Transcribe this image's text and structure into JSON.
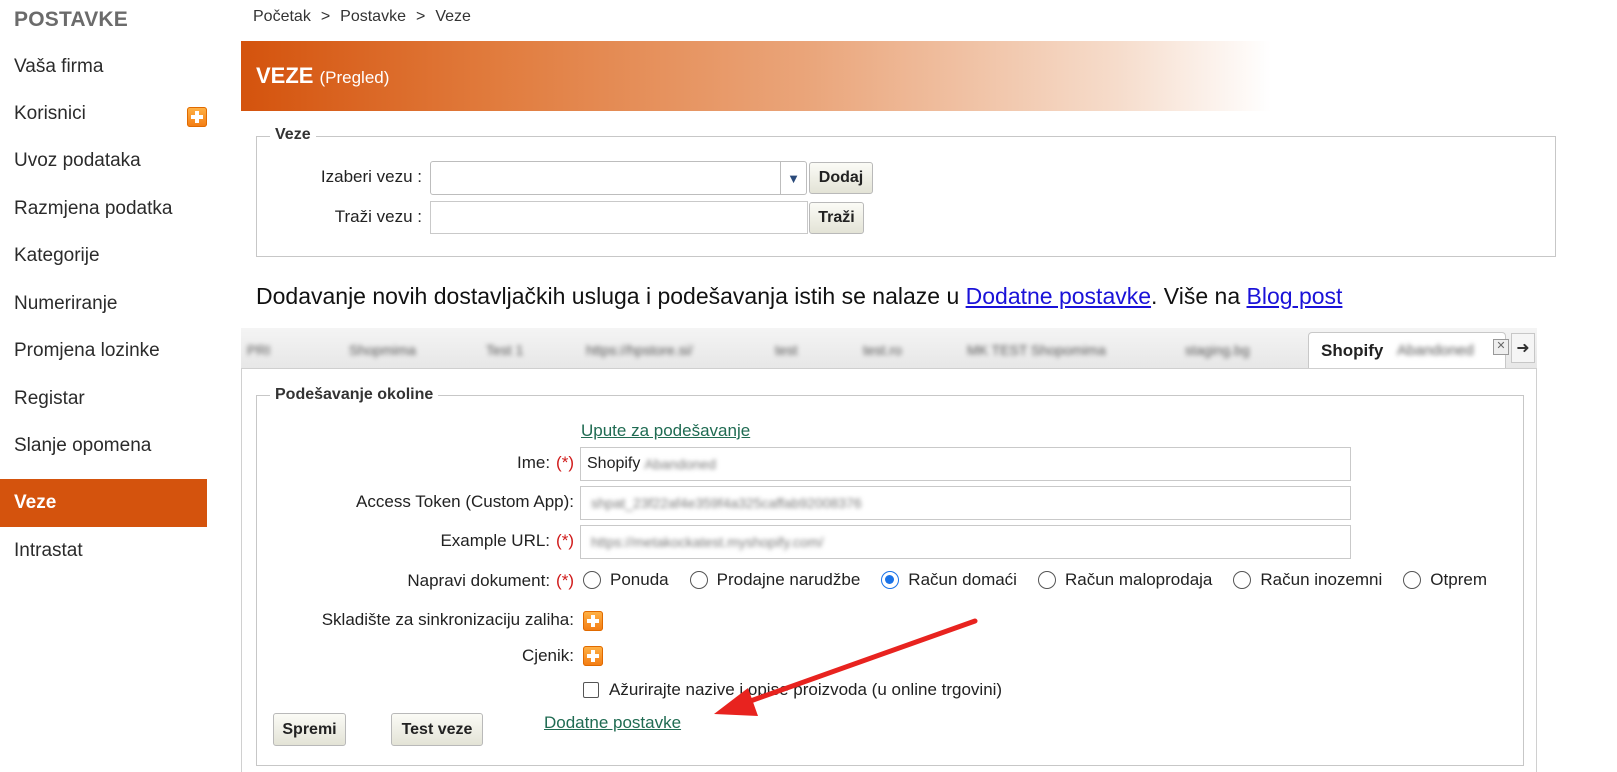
{
  "sidebar": {
    "title": "POSTAVKE",
    "items": [
      {
        "label": "Vaša firma"
      },
      {
        "label": "Korisnici"
      },
      {
        "label": "Uvoz podataka"
      },
      {
        "label": "Razmjena podatka"
      },
      {
        "label": "Kategorije"
      },
      {
        "label": "Numeriranje"
      },
      {
        "label": "Promjena lozinke"
      },
      {
        "label": "Registar"
      },
      {
        "label": "Slanje opomena"
      },
      {
        "label": "Veze"
      },
      {
        "label": "Intrastat"
      }
    ]
  },
  "breadcrumb": [
    "Početak",
    "Postavke",
    "Veze"
  ],
  "breadcrumb_sep": ">",
  "header": {
    "title": "VEZE",
    "subtitle": "(Pregled)",
    "accent": "#d4530d"
  },
  "veze_fieldset": {
    "legend": "Veze",
    "select_label": "Izaberi vezu :",
    "select_value": "",
    "add_button": "Dodaj",
    "search_label": "Traži vezu :",
    "search_value": "",
    "search_button": "Traži"
  },
  "info": {
    "text": "Dodavanje novih dostavljačkih usluga i podešavanja istih se nalaze u ",
    "link1": "Dodatne postavke",
    "middle": ". Više na ",
    "link2": "Blog post"
  },
  "tabs": {
    "items": [
      "PRI",
      "Shopmima",
      "Test 1",
      "https://hpstore.si/",
      "test",
      "test.ro",
      "MK TEST Shopomima",
      "staging.bg"
    ],
    "active": {
      "name": "Shopify",
      "suffix": "Abandoned"
    }
  },
  "env_fieldset": {
    "legend": "Podešavanje okoline",
    "guide_link": "Upute za podešavanje",
    "required_mark": "(*)",
    "name_label": "Ime:",
    "name_value": "Shopify",
    "name_blurred": "Abandoned",
    "token_label": "Access Token (Custom App):",
    "token_value": "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",
    "url_label": "Example URL:",
    "url_value": "https://metakockatest.myshopify.com/",
    "doc_label": "Napravi dokument:",
    "doc_options": [
      "Ponuda",
      "Prodajne narudžbe",
      "Račun domaći",
      "Račun maloprodaja",
      "Račun inozemni",
      "Otprem"
    ],
    "doc_selected": "Račun domaći",
    "warehouse_label": "Skladište za sinkronizaciju zaliha:",
    "pricelist_label": "Cjenik:",
    "update_checkbox_label": "Ažurirajte nazive i opise proizvoda (u online trgovini)",
    "update_checked": false,
    "save_button": "Spremi",
    "test_button": "Test veze",
    "extra_link": "Dodatne postavke"
  },
  "icons": {
    "plus": "plus-icon",
    "dropdown": "chevron-down-icon",
    "close": "close-icon",
    "scroll": "arrow-right-icon",
    "annotation": "red-arrow"
  },
  "colors": {
    "annotation_arrow": "#e8231f",
    "link": "#1f6b52",
    "info_link": "#1a12d8",
    "radio_selected": "#1a73e8"
  }
}
